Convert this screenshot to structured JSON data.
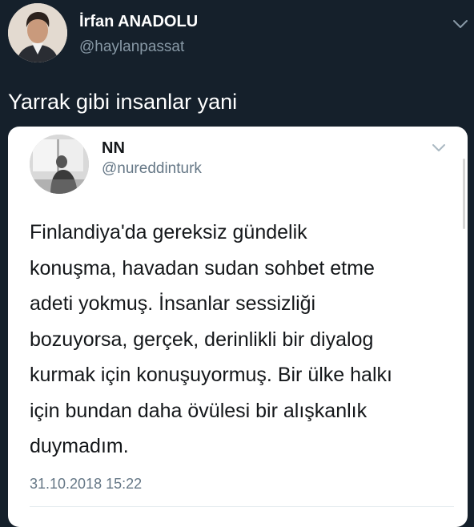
{
  "tweet": {
    "author_name": "İrfan ANADOLU",
    "author_handle": "@haylanpassat",
    "text": "Yarrak gibi insanlar yani"
  },
  "quoted_tweet": {
    "author_name": "NN",
    "author_handle": "@nureddinturk",
    "lines": [
      "Finlandiya'da gereksiz gündelik",
      "konuşma, havadan sudan sohbet etme",
      "adeti yokmuş. İnsanlar sessizliği",
      "bozuyorsa, gerçek, derinlikli bir diyalog",
      "kurmak için konuşuyormuş. Bir ülke halkı",
      "için bundan daha övülesi bir alışkanlık",
      "duymadım."
    ],
    "timestamp": "31.10.2018 15:22"
  },
  "icons": {
    "outer_menu": "chevron-down-icon",
    "quoted_menu": "chevron-down-icon"
  },
  "colors": {
    "background": "#15202b",
    "card": "#ffffff",
    "secondary_text": "#8899a6"
  }
}
